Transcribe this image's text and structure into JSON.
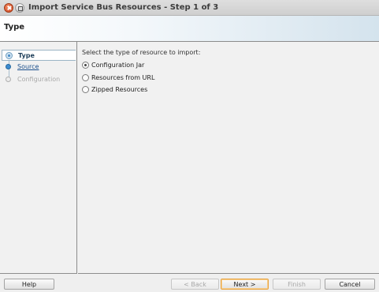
{
  "window": {
    "title": "Import Service Bus Resources - Step 1 of 3",
    "controls": {
      "close_icon": "close-icon",
      "maximize_icon": "maximize-icon"
    }
  },
  "header": {
    "title": "Type"
  },
  "train": {
    "steps": [
      {
        "label": "Type",
        "state": "current"
      },
      {
        "label": "Source",
        "state": "visited"
      },
      {
        "label": "Configuration",
        "state": "disabled"
      }
    ]
  },
  "main": {
    "prompt": "Select the type of resource to import:",
    "options": [
      {
        "label": "Configuration Jar",
        "selected": true
      },
      {
        "label": "Resources from URL",
        "selected": false
      },
      {
        "label": "Zipped Resources",
        "selected": false
      }
    ]
  },
  "buttons": {
    "help": "Help",
    "back": "< Back",
    "next": "Next >",
    "finish": "Finish",
    "cancel": "Cancel"
  },
  "colors": {
    "accent": "#e8a23e",
    "link": "#1b4f8c",
    "train_dot": "#3d8bd0"
  }
}
